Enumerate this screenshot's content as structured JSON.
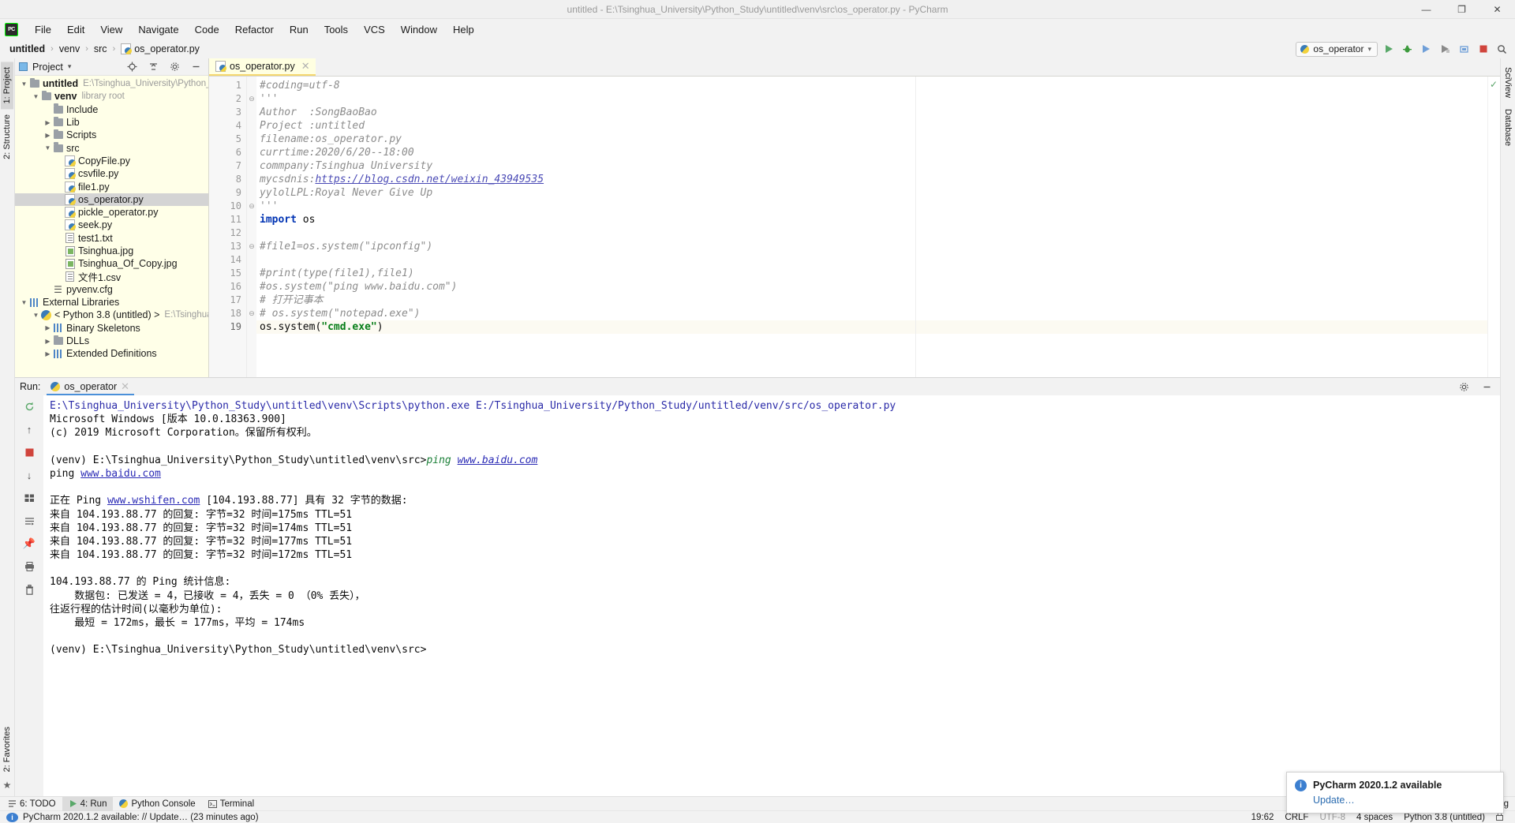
{
  "window": {
    "title": "untitled - E:\\Tsinghua_University\\Python_Study\\untitled\\venv\\src\\os_operator.py - PyCharm",
    "minimize": "—",
    "maximize": "❐",
    "close": "✕"
  },
  "menu": {
    "logo": "PC",
    "items": [
      "File",
      "Edit",
      "View",
      "Navigate",
      "Code",
      "Refactor",
      "Run",
      "Tools",
      "VCS",
      "Window",
      "Help"
    ]
  },
  "breadcrumb": {
    "items": [
      "untitled",
      "venv",
      "src",
      "os_operator.py"
    ],
    "separator": "›"
  },
  "toolbar": {
    "run_config": "os_operator",
    "chevron": "▾",
    "buttons": [
      "run-icon",
      "debug-icon",
      "coverage-icon",
      "profile-icon",
      "attach-icon",
      "stop-icon",
      "search-icon"
    ]
  },
  "left_strip": {
    "tabs": [
      "1: Project",
      "2: Structure"
    ],
    "favorites": "2: Favorites"
  },
  "right_strip": {
    "tabs": [
      "SciView",
      "Database"
    ]
  },
  "project_panel": {
    "title": "Project",
    "chevron": "▾",
    "actions": [
      "locate-icon",
      "collapse-all-icon",
      "settings-icon",
      "hide-icon"
    ],
    "tree": [
      {
        "depth": 0,
        "arrow": "▼",
        "icon": "folder-icon",
        "label": "untitled",
        "bold": true,
        "dim": "E:\\Tsinghua_University\\Python_Study",
        "selected": false
      },
      {
        "depth": 1,
        "arrow": "▼",
        "icon": "folder-icon",
        "label": "venv",
        "bold": true,
        "dim": "library root",
        "selected": false
      },
      {
        "depth": 2,
        "arrow": "",
        "icon": "folder-icon",
        "label": "Include",
        "bold": false,
        "dim": "",
        "selected": false
      },
      {
        "depth": 2,
        "arrow": "▶",
        "icon": "folder-icon",
        "label": "Lib",
        "bold": false,
        "dim": "",
        "selected": false
      },
      {
        "depth": 2,
        "arrow": "▶",
        "icon": "folder-icon",
        "label": "Scripts",
        "bold": false,
        "dim": "",
        "selected": false
      },
      {
        "depth": 2,
        "arrow": "▼",
        "icon": "folder-icon",
        "label": "src",
        "bold": false,
        "dim": "",
        "selected": false
      },
      {
        "depth": 3,
        "arrow": "",
        "icon": "python-file-icon",
        "label": "CopyFile.py",
        "bold": false,
        "dim": "",
        "selected": false
      },
      {
        "depth": 3,
        "arrow": "",
        "icon": "python-file-icon",
        "label": "csvfile.py",
        "bold": false,
        "dim": "",
        "selected": false
      },
      {
        "depth": 3,
        "arrow": "",
        "icon": "python-file-icon",
        "label": "file1.py",
        "bold": false,
        "dim": "",
        "selected": false
      },
      {
        "depth": 3,
        "arrow": "",
        "icon": "python-file-icon",
        "label": "os_operator.py",
        "bold": false,
        "dim": "",
        "selected": true
      },
      {
        "depth": 3,
        "arrow": "",
        "icon": "python-file-icon",
        "label": "pickle_operator.py",
        "bold": false,
        "dim": "",
        "selected": false
      },
      {
        "depth": 3,
        "arrow": "",
        "icon": "python-file-icon",
        "label": "seek.py",
        "bold": false,
        "dim": "",
        "selected": false
      },
      {
        "depth": 3,
        "arrow": "",
        "icon": "text-file-icon",
        "label": "test1.txt",
        "bold": false,
        "dim": "",
        "selected": false
      },
      {
        "depth": 3,
        "arrow": "",
        "icon": "image-file-icon",
        "label": "Tsinghua.jpg",
        "bold": false,
        "dim": "",
        "selected": false
      },
      {
        "depth": 3,
        "arrow": "",
        "icon": "image-file-icon",
        "label": "Tsinghua_Of_Copy.jpg",
        "bold": false,
        "dim": "",
        "selected": false
      },
      {
        "depth": 3,
        "arrow": "",
        "icon": "text-file-icon",
        "label": "文件1.csv",
        "bold": false,
        "dim": "",
        "selected": false
      },
      {
        "depth": 2,
        "arrow": "",
        "icon": "config-file-icon",
        "label": "pyvenv.cfg",
        "bold": false,
        "dim": "",
        "selected": false
      },
      {
        "depth": 0,
        "arrow": "▼",
        "icon": "library-icon",
        "label": "External Libraries",
        "bold": false,
        "dim": "",
        "selected": false
      },
      {
        "depth": 1,
        "arrow": "▼",
        "icon": "python-sdk-icon",
        "label": "< Python 3.8 (untitled) >",
        "bold": false,
        "dim": "E:\\Tsinghua_Univ",
        "selected": false
      },
      {
        "depth": 2,
        "arrow": "▶",
        "icon": "library-icon",
        "label": "Binary Skeletons",
        "bold": false,
        "dim": "",
        "selected": false
      },
      {
        "depth": 2,
        "arrow": "▶",
        "icon": "folder-icon",
        "label": "DLLs",
        "bold": false,
        "dim": "",
        "selected": false
      },
      {
        "depth": 2,
        "arrow": "▶",
        "icon": "library-icon",
        "label": "Extended Definitions",
        "bold": false,
        "dim": "",
        "selected": false
      }
    ]
  },
  "editor": {
    "tab": {
      "label": "os_operator.py",
      "close": "✕"
    },
    "inspection_ok": "✓",
    "lines": [
      {
        "n": 1,
        "fold": "",
        "cur": false,
        "segments": [
          {
            "t": "#coding=utf-8",
            "c": "cmt"
          }
        ]
      },
      {
        "n": 2,
        "fold": "⊖",
        "cur": false,
        "segments": [
          {
            "t": "'''",
            "c": "cmt"
          }
        ]
      },
      {
        "n": 3,
        "fold": "",
        "cur": false,
        "segments": [
          {
            "t": "Author  :SongBaoBao",
            "c": "cmt"
          }
        ]
      },
      {
        "n": 4,
        "fold": "",
        "cur": false,
        "segments": [
          {
            "t": "Project :untitled",
            "c": "cmt"
          }
        ]
      },
      {
        "n": 5,
        "fold": "",
        "cur": false,
        "segments": [
          {
            "t": "filename:os_operator.py",
            "c": "cmt"
          }
        ]
      },
      {
        "n": 6,
        "fold": "",
        "cur": false,
        "segments": [
          {
            "t": "currtime:2020/6/20--18:00",
            "c": "cmt"
          }
        ]
      },
      {
        "n": 7,
        "fold": "",
        "cur": false,
        "segments": [
          {
            "t": "commpany:Tsinghua University",
            "c": "cmt"
          }
        ]
      },
      {
        "n": 8,
        "fold": "",
        "cur": false,
        "segments": [
          {
            "t": "mycsdnis:",
            "c": "cmt"
          },
          {
            "t": "https://blog.csdn.net/weixin_43949535",
            "c": "lnk"
          }
        ]
      },
      {
        "n": 9,
        "fold": "",
        "cur": false,
        "segments": [
          {
            "t": "yylolLPL:Royal Never Give Up",
            "c": "cmt"
          }
        ]
      },
      {
        "n": 10,
        "fold": "⊖",
        "cur": false,
        "segments": [
          {
            "t": "'''",
            "c": "cmt"
          }
        ]
      },
      {
        "n": 11,
        "fold": "",
        "cur": false,
        "segments": [
          {
            "t": "import ",
            "c": "kw"
          },
          {
            "t": "os",
            "c": "plain"
          }
        ]
      },
      {
        "n": 12,
        "fold": "",
        "cur": false,
        "segments": [
          {
            "t": "",
            "c": "plain"
          }
        ]
      },
      {
        "n": 13,
        "fold": "⊖",
        "cur": false,
        "segments": [
          {
            "t": "#file1=os.system(\"ipconfig\")",
            "c": "cmt"
          }
        ]
      },
      {
        "n": 14,
        "fold": "",
        "cur": false,
        "segments": [
          {
            "t": "",
            "c": "plain"
          }
        ]
      },
      {
        "n": 15,
        "fold": "",
        "cur": false,
        "segments": [
          {
            "t": "#print(type(file1),file1)",
            "c": "cmt"
          }
        ]
      },
      {
        "n": 16,
        "fold": "",
        "cur": false,
        "segments": [
          {
            "t": "#os.system(\"ping www.baidu.com\")",
            "c": "cmt"
          }
        ]
      },
      {
        "n": 17,
        "fold": "",
        "cur": false,
        "segments": [
          {
            "t": "# 打开记事本",
            "c": "cmt"
          }
        ]
      },
      {
        "n": 18,
        "fold": "⊖",
        "cur": false,
        "segments": [
          {
            "t": "# os.system(\"notepad.exe\")",
            "c": "cmt"
          }
        ]
      },
      {
        "n": 19,
        "fold": "",
        "cur": true,
        "segments": [
          {
            "t": "os.system(",
            "c": "plain"
          },
          {
            "t": "\"cmd.exe\"",
            "c": "str"
          },
          {
            "t": ")",
            "c": "plain"
          }
        ]
      }
    ]
  },
  "run_panel": {
    "label": "Run:",
    "tab": "os_operator",
    "tab_close": "✕",
    "actions": [
      "settings-icon",
      "hide-icon"
    ],
    "tools": [
      "rerun-icon",
      "scroll-up-icon",
      "stop-icon",
      "scroll-down-icon",
      "print-grid-icon",
      "soft-wrap-icon",
      "pin-icon",
      "print-icon",
      "trash-icon"
    ],
    "output": [
      {
        "type": "blue",
        "text": "E:\\Tsinghua_University\\Python_Study\\untitled\\venv\\Scripts\\python.exe E:/Tsinghua_University/Python_Study/untitled/venv/src/os_operator.py"
      },
      {
        "type": "plain",
        "text": "Microsoft Windows [版本 10.0.18363.900]"
      },
      {
        "type": "plain",
        "text": "(c) 2019 Microsoft Corporation。保留所有权利。"
      },
      {
        "type": "plain",
        "text": ""
      },
      {
        "type": "prompt",
        "pre": "(venv) E:\\Tsinghua_University\\Python_Study\\untitled\\venv\\src>",
        "cmd": "ping ",
        "link": "www.baidu.com"
      },
      {
        "type": "pinglink",
        "pre": "ping ",
        "link": "www.baidu.com"
      },
      {
        "type": "plain",
        "text": ""
      },
      {
        "type": "pingstart",
        "pre": "正在 Ping ",
        "link": "www.wshifen.com",
        "post": " [104.193.88.77] 具有 32 字节的数据:"
      },
      {
        "type": "plain",
        "text": "来自 104.193.88.77 的回复: 字节=32 时间=175ms TTL=51"
      },
      {
        "type": "plain",
        "text": "来自 104.193.88.77 的回复: 字节=32 时间=174ms TTL=51"
      },
      {
        "type": "plain",
        "text": "来自 104.193.88.77 的回复: 字节=32 时间=177ms TTL=51"
      },
      {
        "type": "plain",
        "text": "来自 104.193.88.77 的回复: 字节=32 时间=172ms TTL=51"
      },
      {
        "type": "plain",
        "text": ""
      },
      {
        "type": "plain",
        "text": "104.193.88.77 的 Ping 统计信息:"
      },
      {
        "type": "plain",
        "text": "    数据包: 已发送 = 4，已接收 = 4，丢失 = 0 （0% 丢失），"
      },
      {
        "type": "plain",
        "text": "往返行程的估计时间(以毫秒为单位):"
      },
      {
        "type": "plain",
        "text": "    最短 = 172ms，最长 = 177ms，平均 = 174ms"
      },
      {
        "type": "plain",
        "text": ""
      },
      {
        "type": "plain",
        "text": "(venv) E:\\Tsinghua_University\\Python_Study\\untitled\\venv\\src>"
      }
    ]
  },
  "notification": {
    "icon": "info-icon",
    "title": "PyCharm 2020.1.2 available",
    "action": "Update…"
  },
  "bottom_bar": {
    "tabs": [
      {
        "icon": "todo-icon",
        "label": "6: TODO",
        "selected": false
      },
      {
        "icon": "run-icon",
        "label": "4: Run",
        "selected": true
      },
      {
        "icon": "python-console-icon",
        "label": "Python Console",
        "selected": false
      },
      {
        "icon": "terminal-icon",
        "label": "Terminal",
        "selected": false
      }
    ],
    "event_log": {
      "icon": "event-log-icon",
      "label": "Event Log"
    }
  },
  "status_bar": {
    "message_icon": "info-icon",
    "message": "PyCharm 2020.1.2 available: // Update… (23 minutes ago)",
    "caret": "19:62",
    "line_sep": "CRLF",
    "encoding": "UTF-8",
    "indent": "4 spaces",
    "interpreter": "Python 3.8 (untitled)",
    "lock_icon": "lock-icon"
  }
}
